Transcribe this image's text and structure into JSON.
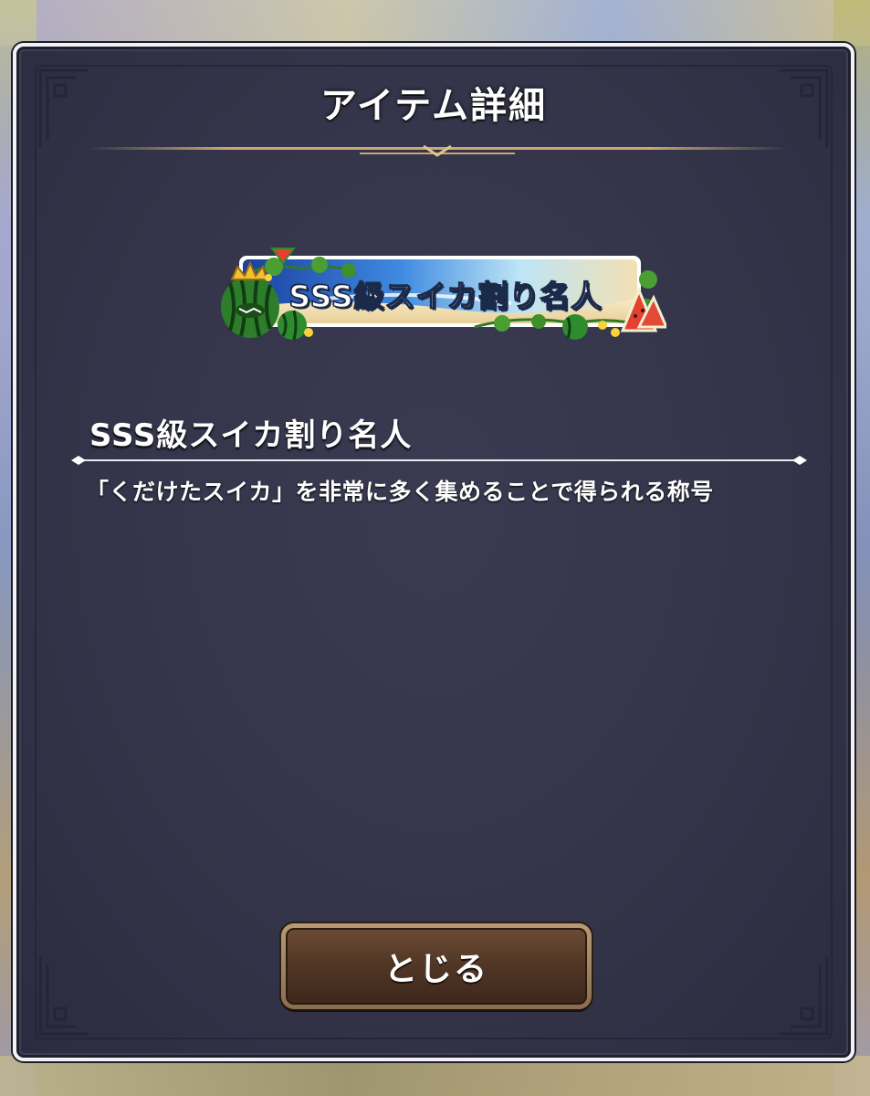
{
  "dialog": {
    "title": "アイテム詳細",
    "banner": {
      "text": "SSS級スイカ割り名人"
    },
    "item": {
      "name": "SSS級スイカ割り名人",
      "description": "「くだけたスイカ」を非常に多く集めることで得られる称号"
    },
    "close_button": {
      "label": "とじる"
    }
  },
  "colors": {
    "panel": "#34344a",
    "frame": "#f2f2f6",
    "gold_divider": "#c8a870",
    "button": "#4e3424",
    "button_border": "#b89a74"
  }
}
